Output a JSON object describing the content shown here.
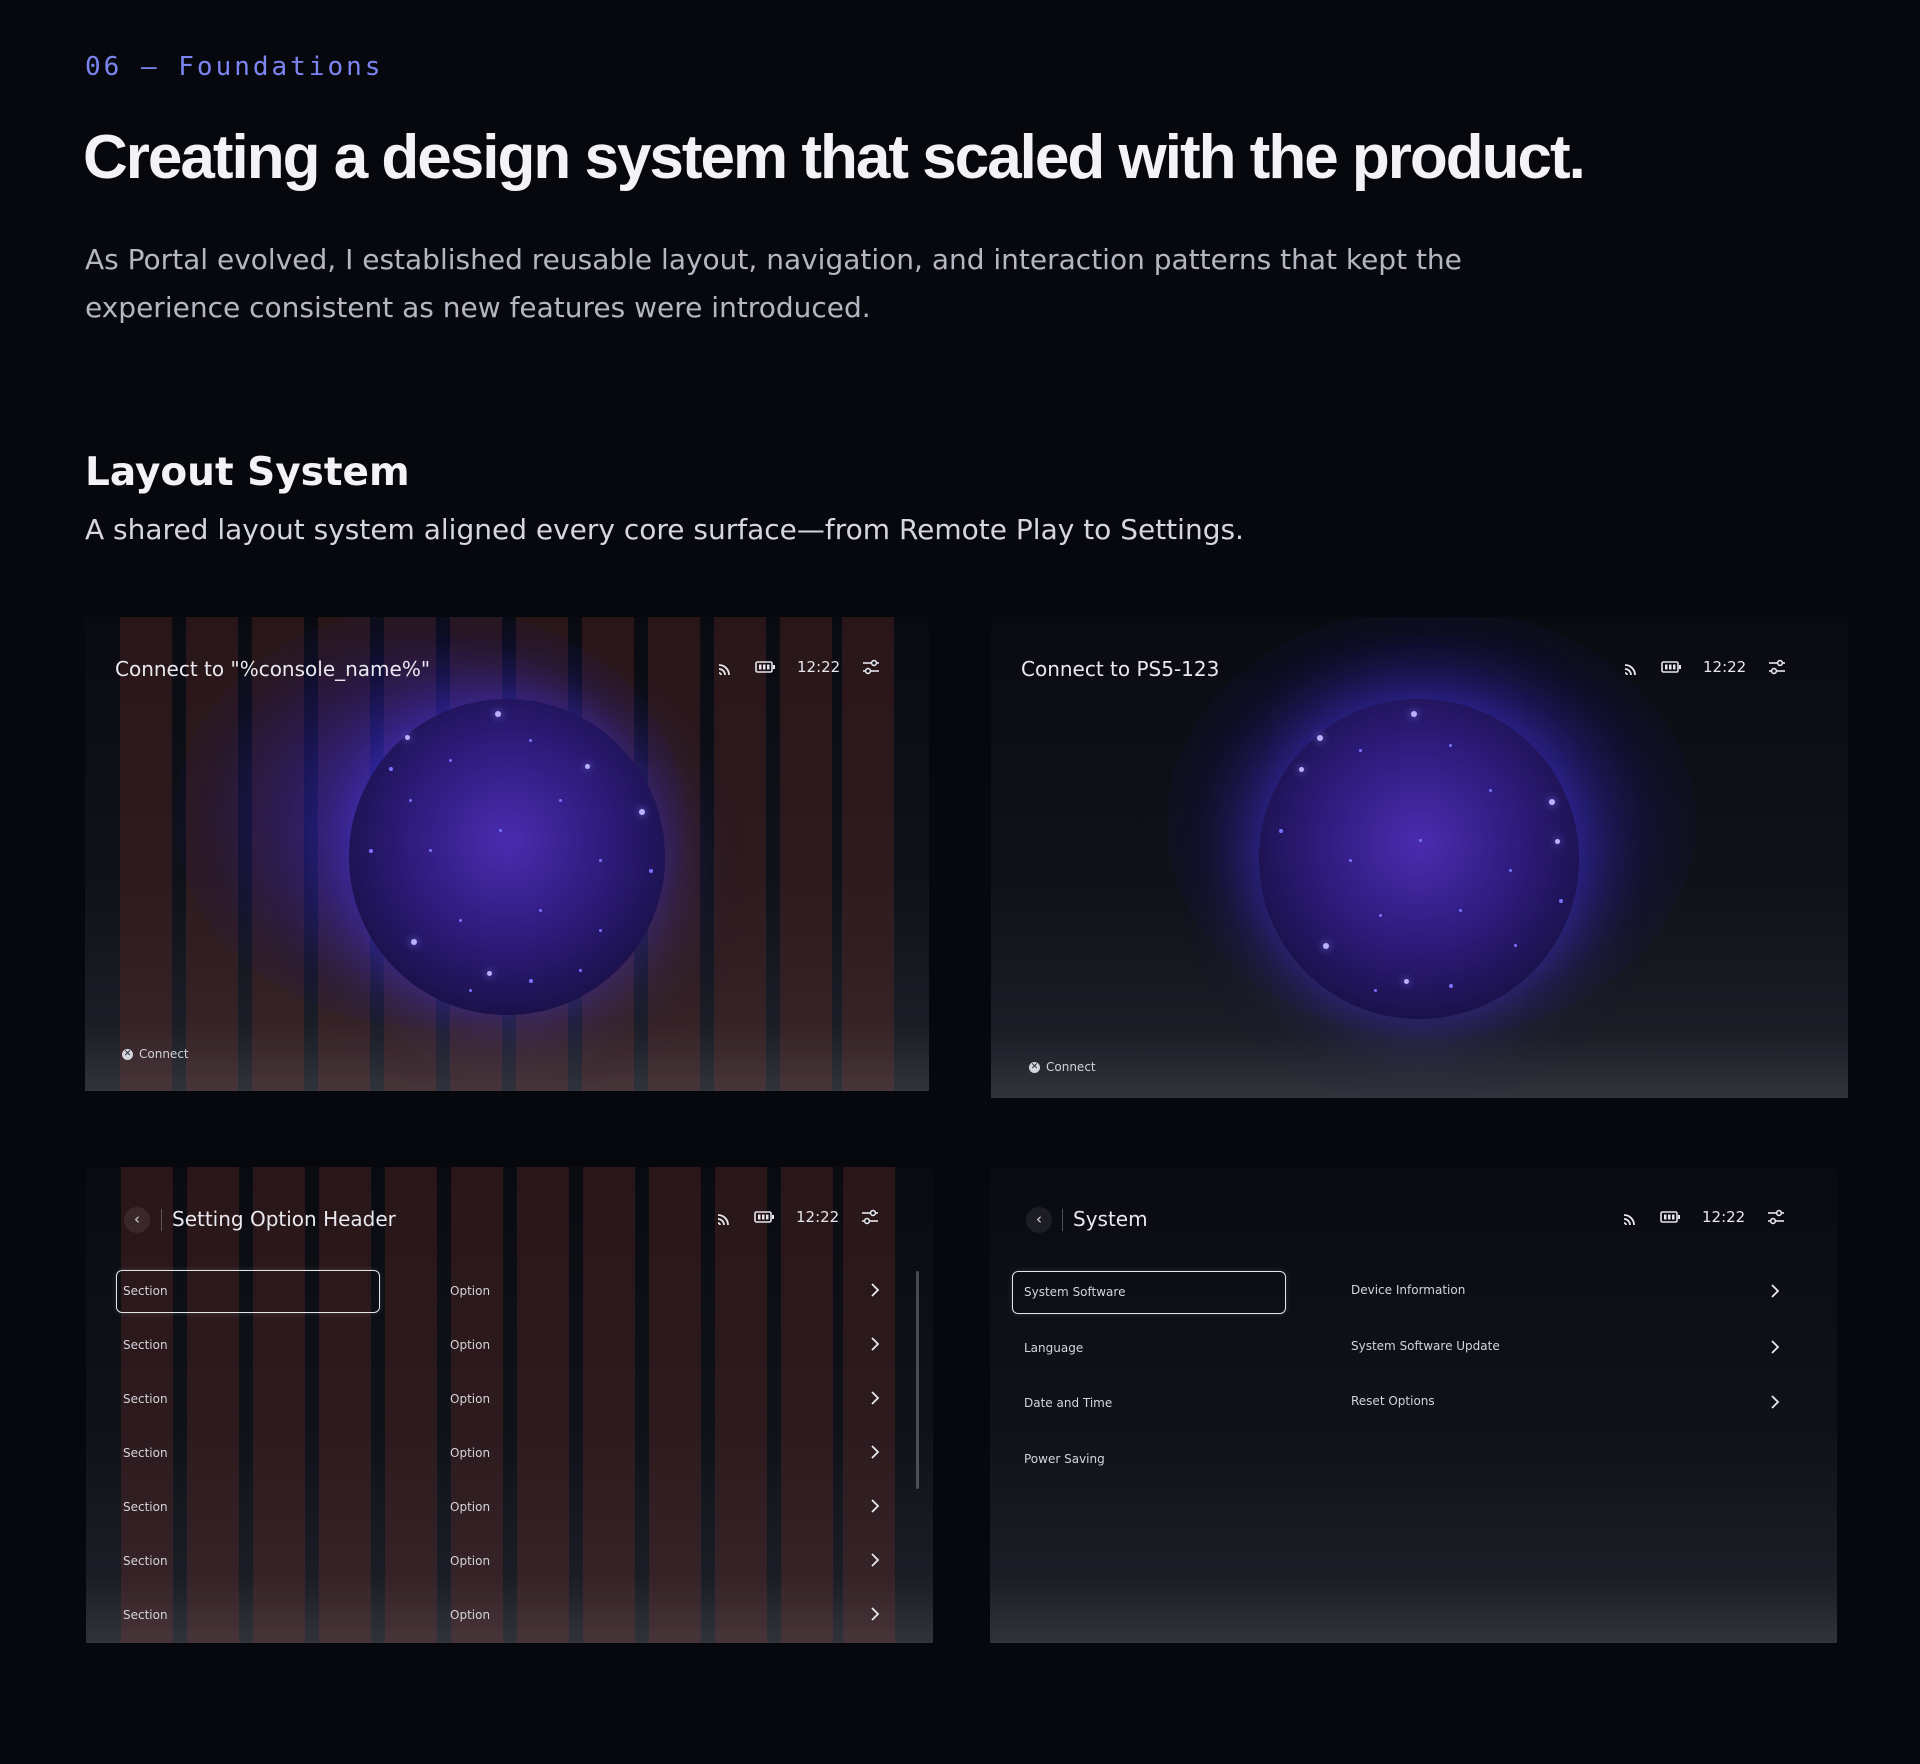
{
  "eyebrow": "06 — Foundations",
  "headline": "Creating a design system that scaled with the product.",
  "intro": "As Portal evolved, I established reusable layout, navigation, and interaction patterns that kept the experience consistent as new features were introduced.",
  "section": {
    "title": "Layout System",
    "subtitle": "A shared layout system aligned every core surface—from Remote Play to Settings."
  },
  "status": {
    "time": "12:22",
    "icons": [
      "cast-icon",
      "battery-icon",
      "settings-sliders-icon"
    ]
  },
  "screens": {
    "connect_template": {
      "title": "Connect to \"%console_name%\"",
      "action_icon": "cross-button-icon",
      "action_label": "Connect"
    },
    "connect_final": {
      "title": "Connect to PS5-123",
      "action_icon": "cross-button-icon",
      "action_label": "Connect"
    },
    "settings_template": {
      "title": "Setting Option Header",
      "rows": [
        {
          "section": "Section",
          "option": "Option"
        },
        {
          "section": "Section",
          "option": "Option"
        },
        {
          "section": "Section",
          "option": "Option"
        },
        {
          "section": "Section",
          "option": "Option"
        },
        {
          "section": "Section",
          "option": "Option"
        },
        {
          "section": "Section",
          "option": "Option"
        },
        {
          "section": "Section",
          "option": "Option"
        }
      ]
    },
    "settings_final": {
      "title": "System",
      "left_items": [
        "System Software",
        "Language",
        "Date and Time",
        "Power Saving"
      ],
      "right_items": [
        "Device Information",
        "System Software Update",
        "Reset Options"
      ]
    }
  }
}
